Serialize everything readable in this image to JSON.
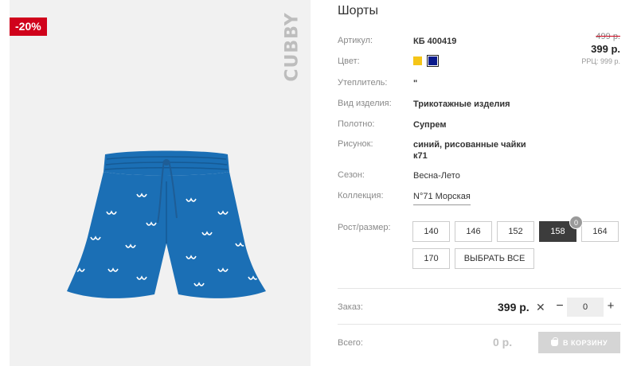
{
  "badge": {
    "discount": "-20%"
  },
  "brand": {
    "logo_text": "CUBBY"
  },
  "product": {
    "title": "Шорты",
    "attributes": [
      {
        "label": "Артикул:",
        "value": "КБ 400419"
      },
      {
        "label": "Цвет:"
      },
      {
        "label": "Утеплитель:",
        "value": "\""
      },
      {
        "label": "Вид изделия:",
        "value": "Трикотажные изделия"
      },
      {
        "label": "Полотно:",
        "value": "Супрем"
      },
      {
        "label": "Рисунок:",
        "value": "синий, рисованные чайки к71"
      },
      {
        "label": "Сезон:",
        "value": "Весна-Лето"
      },
      {
        "label": "Коллекция:",
        "value": "N°71 Морская"
      }
    ],
    "colors": [
      {
        "name": "yellow",
        "hex": "#f5c518"
      },
      {
        "name": "navy",
        "hex": "#0a1a8c"
      }
    ]
  },
  "price": {
    "old": "499 р.",
    "new": "399 р.",
    "rrp": "РРЦ: 999 р."
  },
  "sizes": {
    "label": "Рост/размер:",
    "options": [
      "140",
      "146",
      "152",
      "158",
      "164",
      "170"
    ],
    "selected": "158",
    "selected_count": "0",
    "select_all": "ВЫБРАТЬ ВСЕ"
  },
  "order": {
    "label": "Заказ:",
    "unit_price": "399 р.",
    "times": "✕",
    "minus": "−",
    "plus": "+",
    "quantity": "0"
  },
  "total": {
    "label": "Всего:",
    "value": "0 р.",
    "cart_button": "В КОРЗИНУ"
  },
  "colors": {
    "accent_red": "#d0021b",
    "active_size": "#3c3c3c",
    "shorts_blue": "#1b6fb5"
  }
}
